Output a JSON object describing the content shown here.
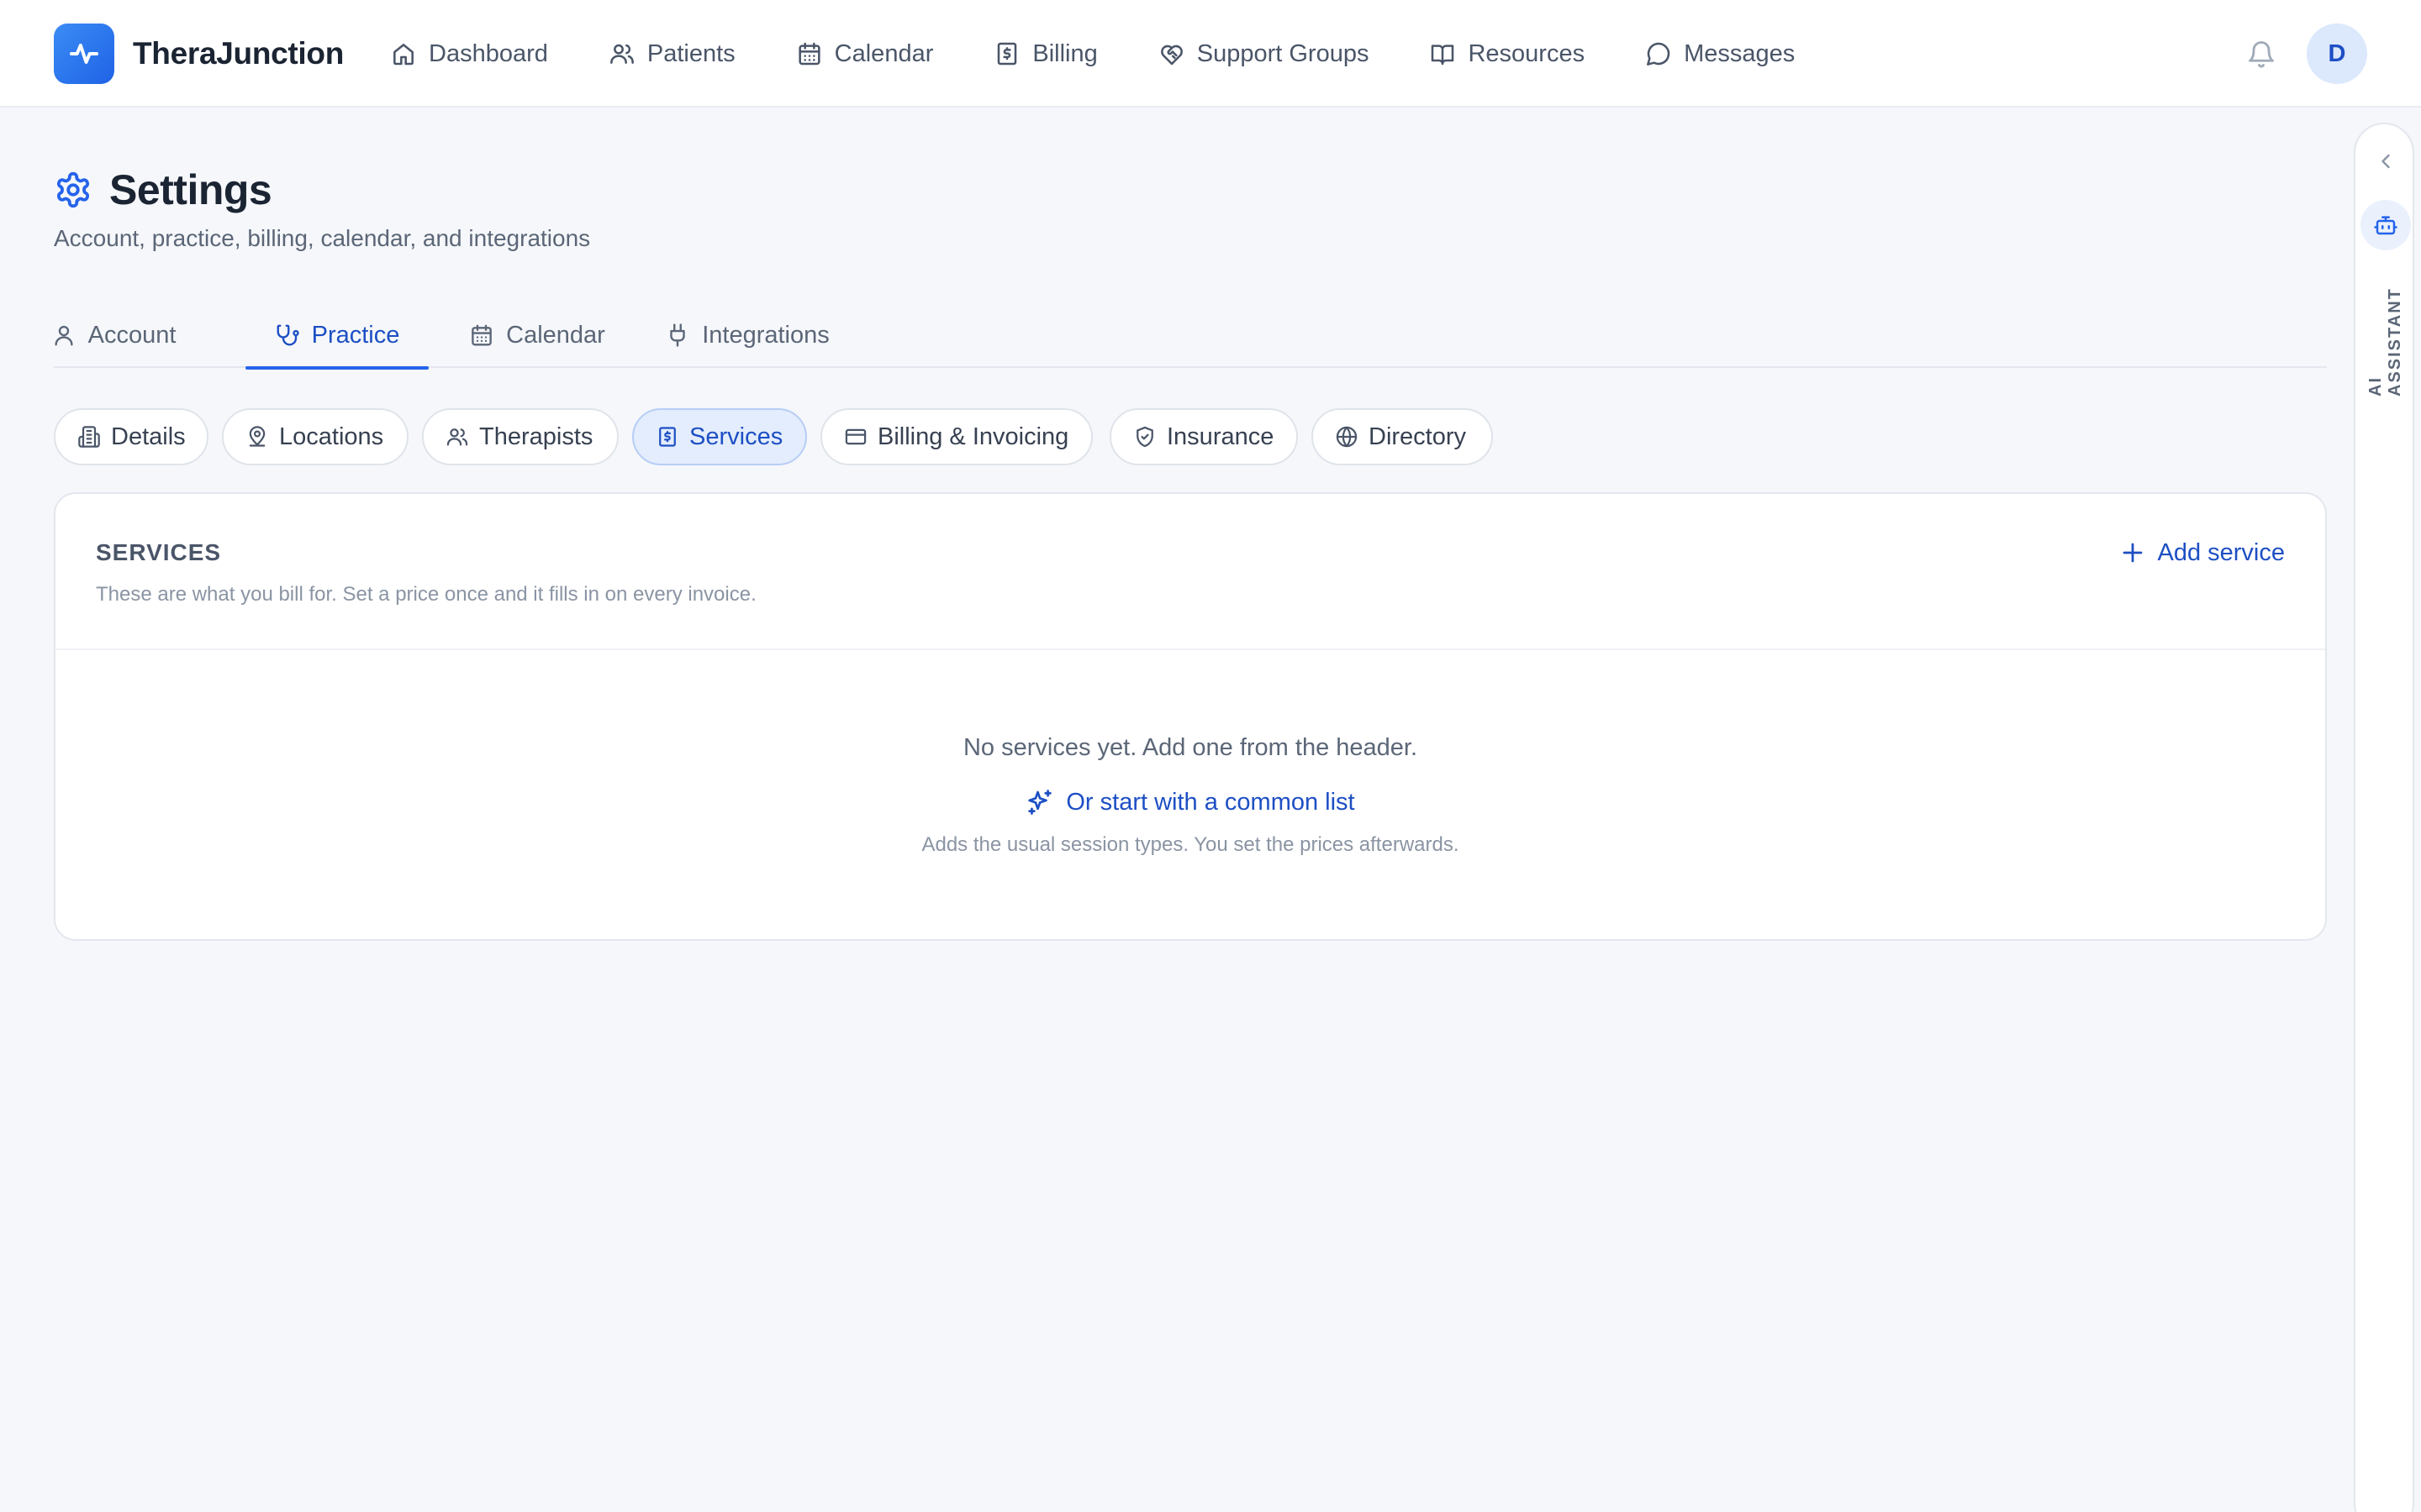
{
  "app": {
    "name": "TheraJunction",
    "logo_icon": "activity-pulse-icon",
    "brand_color": "#2563eb"
  },
  "nav": {
    "items": [
      {
        "label": "Dashboard",
        "icon": "home-icon"
      },
      {
        "label": "Patients",
        "icon": "users-icon"
      },
      {
        "label": "Calendar",
        "icon": "calendar-icon"
      },
      {
        "label": "Billing",
        "icon": "receipt-dollar-icon"
      },
      {
        "label": "Support Groups",
        "icon": "heart-handshake-icon"
      },
      {
        "label": "Resources",
        "icon": "book-open-icon"
      },
      {
        "label": "Messages",
        "icon": "message-circle-icon"
      }
    ],
    "notifications_icon": "bell-icon",
    "avatar_initial": "D"
  },
  "page": {
    "title": "Settings",
    "title_icon": "gear-icon",
    "subtitle": "Account, practice, billing, calendar, and integrations"
  },
  "tabs": [
    {
      "label": "Account",
      "icon": "user-icon",
      "active": false
    },
    {
      "label": "Practice",
      "icon": "stethoscope-icon",
      "active": true
    },
    {
      "label": "Calendar",
      "icon": "calendar-icon",
      "active": false
    },
    {
      "label": "Integrations",
      "icon": "plug-icon",
      "active": false
    }
  ],
  "subtabs": [
    {
      "label": "Details",
      "icon": "building-icon",
      "active": false
    },
    {
      "label": "Locations",
      "icon": "map-pin-user-icon",
      "active": false
    },
    {
      "label": "Therapists",
      "icon": "users-icon",
      "active": false
    },
    {
      "label": "Services",
      "icon": "receipt-dollar-icon",
      "active": true
    },
    {
      "label": "Billing & Invoicing",
      "icon": "credit-card-icon",
      "active": false
    },
    {
      "label": "Insurance",
      "icon": "shield-check-icon",
      "active": false
    },
    {
      "label": "Directory",
      "icon": "globe-icon",
      "active": false
    }
  ],
  "services_card": {
    "title": "SERVICES",
    "description": "These are what you bill for. Set a price once and it fills in on every invoice.",
    "add_label": "Add service",
    "empty_text": "No services yet. Add one from the header.",
    "common_list_label": "Or start with a common list",
    "common_list_hint": "Adds the usual session types. You set the prices afterwards."
  },
  "ai_assistant": {
    "label": "AI ASSISTANT",
    "collapse_icon": "chevron-left-icon",
    "bot_icon": "bot-icon"
  },
  "colors": {
    "accent": "#2563eb",
    "accent_text": "#1d4fc4",
    "active_pill_bg": "#e3edfd",
    "page_bg": "#f5f7fa"
  }
}
